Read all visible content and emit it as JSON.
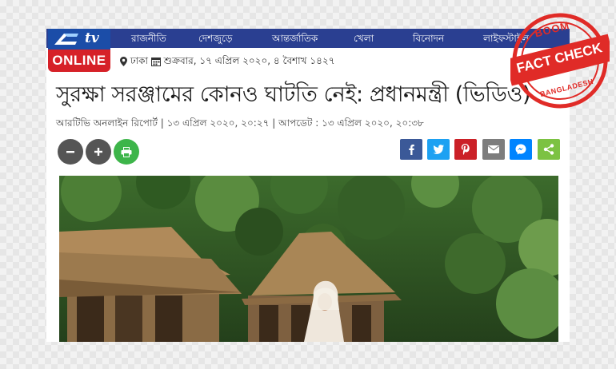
{
  "nav": {
    "items": [
      "রাজনীতি",
      "দেশজুড়ে",
      "আন্তর্জাতিক",
      "খেলা",
      "বিনোদন",
      "লাইফস্টাইল"
    ]
  },
  "logo": {
    "top": "tv",
    "bottom": "ONLINE"
  },
  "dateline": {
    "location": "ঢাকা",
    "date": "শুক্রবার, ১৭ এপ্রিল ২০২০, ৪ বৈশাখ ১৪২৭"
  },
  "article": {
    "headline": "সুরক্ষা সরঞ্জামের কোনও ঘাটতি নেই: প্রধানমন্ত্রী (ভিডিও)",
    "byline": "আরটিভি অনলাইন রিপোর্ট  |  ১৩ এপ্রিল ২০২০, ২০:২৭ | আপডেট : ১৩ এপ্রিল ২০২০, ২০:৩৮"
  },
  "tools": {
    "zoom_out": {
      "icon": "minus-icon",
      "color": "#555555"
    },
    "zoom_in": {
      "icon": "plus-icon",
      "color": "#555555"
    },
    "print": {
      "icon": "print-icon",
      "color": "#3db54a"
    }
  },
  "share": [
    {
      "name": "facebook",
      "icon": "facebook-icon",
      "glyph": "f",
      "color": "#3b5998"
    },
    {
      "name": "twitter",
      "icon": "twitter-icon",
      "glyph": "t",
      "color": "#1da1f2"
    },
    {
      "name": "pinterest",
      "icon": "pinterest-icon",
      "glyph": "p",
      "color": "#cb2027"
    },
    {
      "name": "email",
      "icon": "email-icon",
      "glyph": "✉",
      "color": "#7d7d7d"
    },
    {
      "name": "messenger",
      "icon": "messenger-icon",
      "glyph": "m",
      "color": "#0084ff"
    },
    {
      "name": "share",
      "icon": "share-icon",
      "glyph": "<",
      "color": "#7cc242"
    }
  ],
  "stamp": {
    "top": "BOOM",
    "middle": "FACT CHECK",
    "bottom": "BANGLADESH",
    "color": "#e02b27"
  },
  "colors": {
    "navbar": "#2a3f91",
    "logo_blue": "#1b4da8",
    "logo_red": "#d62128"
  }
}
